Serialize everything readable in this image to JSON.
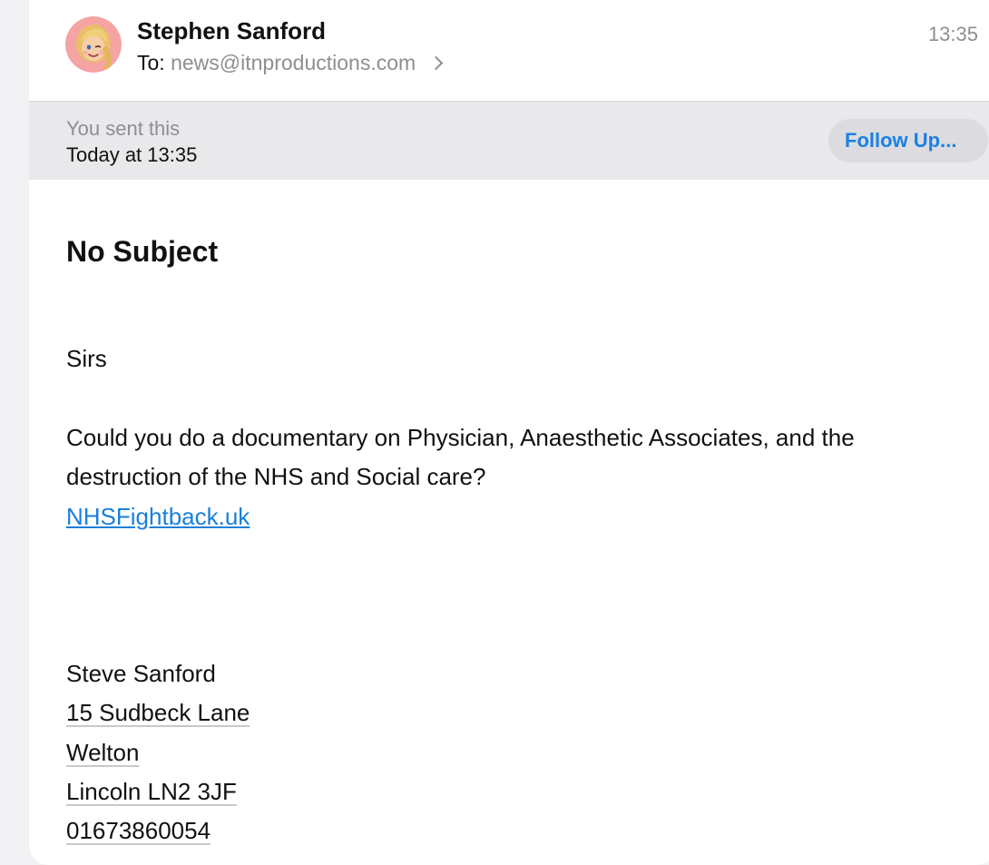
{
  "header": {
    "sender_name": "Stephen Sanford",
    "to_label": "To:",
    "to_address": "news@itnproductions.com",
    "time": "13:35"
  },
  "status_bar": {
    "sent_label": "You sent this",
    "sent_date": "Today at 13:35",
    "follow_up_label": "Follow Up..."
  },
  "message": {
    "subject": "No Subject",
    "greeting": "Sirs",
    "body_line_1": "Could you do a documentary on Physician, Anaesthetic Associates, and the",
    "body_line_2": "destruction of the NHS and Social care?",
    "link": "NHSFightback.uk",
    "signature": {
      "name": "Steve Sanford",
      "address_line_1": "15 Sudbeck Lane",
      "address_line_2": "Welton",
      "address_line_3": "Lincoln LN2 3JF",
      "phone": "01673860054"
    }
  },
  "colors": {
    "accent": "#1a80e6",
    "link": "#1a7fd9",
    "secondary_text": "#8e8e93",
    "status_bar_bg": "#e9e9ec"
  },
  "icons": {
    "avatar": "memoji-avatar",
    "recipient_disclosure": "chevron-right-icon"
  }
}
